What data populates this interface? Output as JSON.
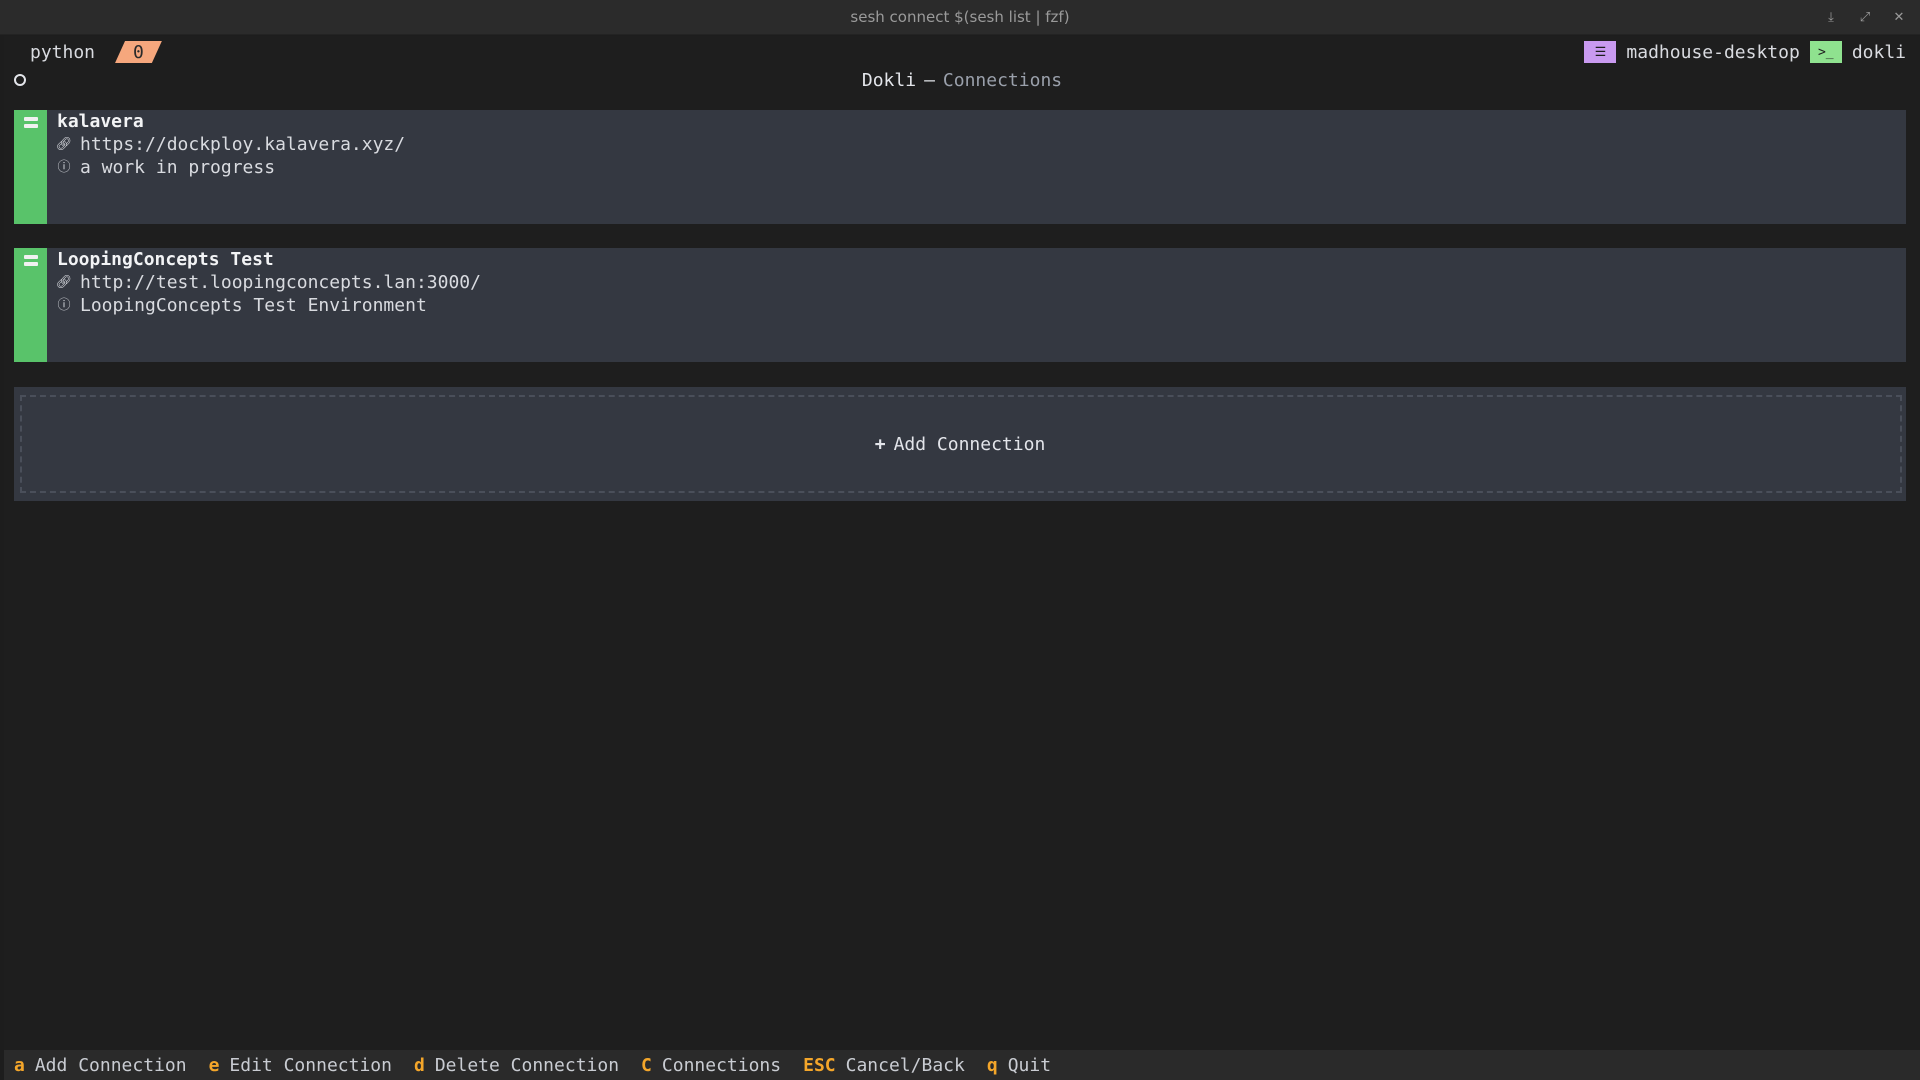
{
  "window": {
    "title": "sesh connect $(sesh list | fzf)"
  },
  "tmux": {
    "session": "python",
    "window_index": "0",
    "host": "madhouse-desktop",
    "app": "dokli",
    "colors": {
      "window_bg": "#f6a77d",
      "host_badge": "#c99af0",
      "app_badge": "#8fe28f"
    }
  },
  "header": {
    "name": "Dokli",
    "separator": "—",
    "section": "Connections"
  },
  "connections": [
    {
      "name": "kalavera",
      "url": "https://dockploy.kalavera.xyz/",
      "description": "a work in progress",
      "status_color": "#59c36a"
    },
    {
      "name": "LoopingConcepts Test",
      "url": "http://test.loopingconcepts.lan:3000/",
      "description": "LoopingConcepts Test Environment",
      "status_color": "#59c36a"
    }
  ],
  "add_connection": {
    "icon": "+",
    "label": "Add Connection"
  },
  "keybar": [
    {
      "key": "a",
      "label": "Add Connection"
    },
    {
      "key": "e",
      "label": "Edit Connection"
    },
    {
      "key": "d",
      "label": "Delete Connection"
    },
    {
      "key": "C",
      "label": "Connections"
    },
    {
      "key": "ESC",
      "label": "Cancel/Back"
    },
    {
      "key": "q",
      "label": "Quit"
    }
  ],
  "icons": {
    "server": "server-icon",
    "link": "link-icon",
    "info": "info-icon",
    "terminal": "terminal-icon"
  }
}
